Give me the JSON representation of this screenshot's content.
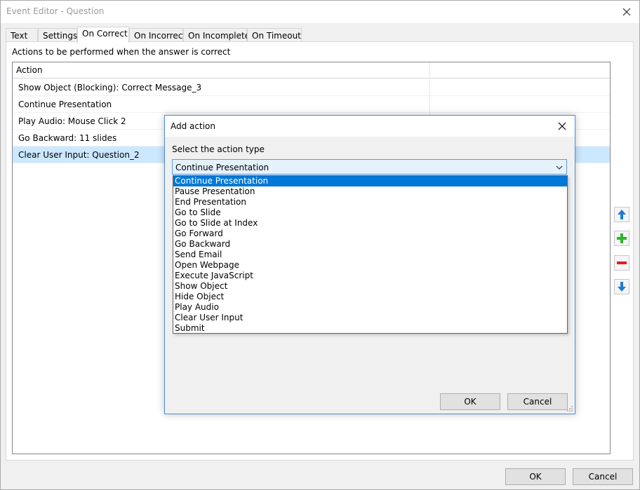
{
  "window": {
    "title": "Event Editor - Question"
  },
  "tabs": [
    {
      "label": "Text"
    },
    {
      "label": "Settings"
    },
    {
      "label": "On Correct",
      "active": true
    },
    {
      "label": "On Incorrect"
    },
    {
      "label": "On Incomplete"
    },
    {
      "label": "On Timeout"
    }
  ],
  "panel": {
    "caption": "Actions to be performed when the answer is correct",
    "table": {
      "columns": [
        "Action",
        ""
      ],
      "rows": [
        {
          "action": "Show Object (Blocking): Correct Message_3"
        },
        {
          "action": "Continue Presentation"
        },
        {
          "action": "Play Audio: Mouse Click 2"
        },
        {
          "action": "Go Backward: 11 slides"
        },
        {
          "action": "Clear User Input: Question_2",
          "selected": true
        }
      ]
    }
  },
  "side_buttons": [
    {
      "icon": "move-up-arrow-icon",
      "color": "#1e7bd4"
    },
    {
      "icon": "add-plus-icon",
      "color": "#2db52d"
    },
    {
      "icon": "remove-minus-icon",
      "color": "#e02020"
    },
    {
      "icon": "move-down-arrow-icon",
      "color": "#1e7bd4"
    }
  ],
  "dialog": {
    "title": "Add action",
    "select_label": "Select the action type",
    "selected_value": "Continue Presentation",
    "options": [
      "Continue Presentation",
      "Pause Presentation",
      "End Presentation",
      "Go to Slide",
      "Go to Slide at Index",
      "Go Forward",
      "Go Backward",
      "Send Email",
      "Open Webpage",
      "Execute JavaScript",
      "Show Object",
      "Hide Object",
      "Play Audio",
      "Clear User Input",
      "Submit"
    ],
    "ok_label": "OK",
    "cancel_label": "Cancel"
  },
  "footer": {
    "ok_label": "OK",
    "cancel_label": "Cancel"
  },
  "colors": {
    "selection": "#0078d7",
    "row_selected": "#cce8ff",
    "dialog_border": "#4a8fd4"
  }
}
